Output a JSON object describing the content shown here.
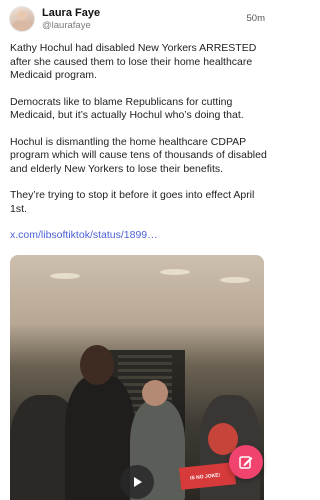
{
  "post": {
    "author_name": "Laura Faye",
    "author_handle": "@laurafaye",
    "timestamp": "50m",
    "paragraphs": [
      "Kathy Hochul had disabled New Yorkers ARRESTED after she caused them to lose their home healthcare Medicaid program.",
      "Democrats like to blame Republicans for cutting Medicaid, but it’s actually Hochul who’s doing that.",
      "Hochul is dismantling the home healthcare CDPAP program which will cause tens of thousands of disabled and elderly New Yorkers to lose their benefits.",
      "They’re trying to stop it before it goes into effect April 1st."
    ],
    "link_text": "x.com/libsoftiktok/status/1899…"
  },
  "video": {
    "sign_text": "IS NO JOKE!",
    "play_icon": "play-icon"
  },
  "fab": {
    "icon": "compose-icon",
    "color": "#f0436e"
  },
  "colors": {
    "link": "#4b5fd6",
    "handle": "#7a7a7a"
  }
}
